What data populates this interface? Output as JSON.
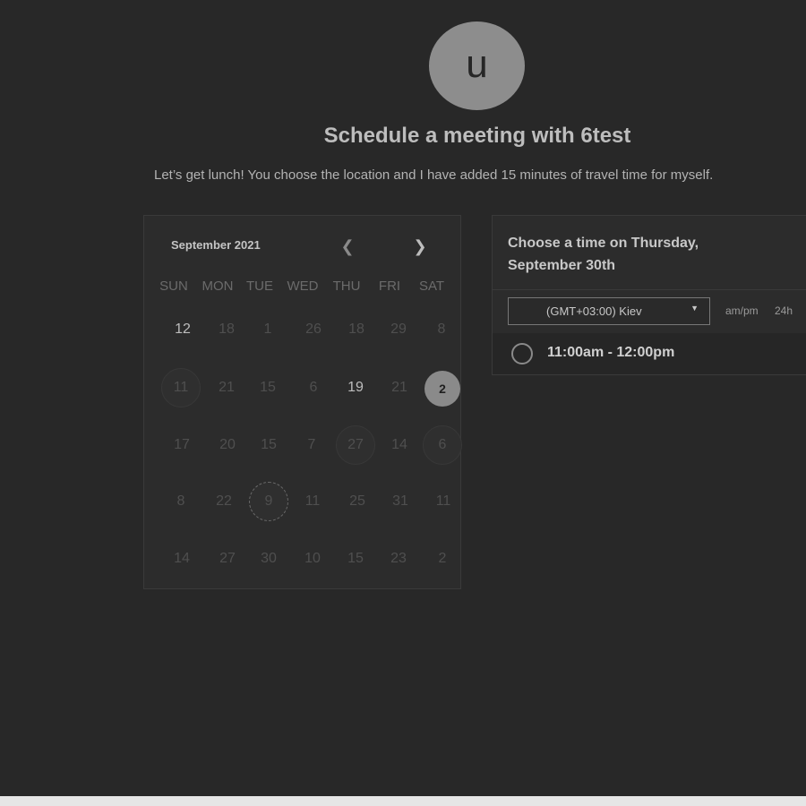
{
  "profile": {
    "avatar_letter": "u"
  },
  "header": {
    "title": "Schedule a meeting with 6test",
    "subtitle": "Let’s get lunch! You choose the location and I have added 15 minutes of travel time for myself."
  },
  "calendar": {
    "month_label": "September 2021",
    "prev_icon": "chevron-left-icon",
    "next_icon": "chevron-right-icon",
    "weekdays": [
      "SUN",
      "MON",
      "TUE",
      "WED",
      "THU",
      "FRI",
      "SAT"
    ],
    "weeks": [
      [
        "12",
        "18",
        "1",
        "26",
        "18",
        "29",
        "8"
      ],
      [
        "11",
        "21",
        "15",
        "6",
        "19",
        "21",
        "2"
      ],
      [
        "17",
        "20",
        "15",
        "7",
        "27",
        "14",
        "6"
      ],
      [
        "8",
        "22",
        "9",
        "11",
        "25",
        "31",
        "11"
      ],
      [
        "14",
        "27",
        "30",
        "10",
        "15",
        "23",
        "2"
      ]
    ],
    "selected_day": "2"
  },
  "time_panel": {
    "heading": "Choose a time on Thursday, September 30th",
    "timezone": "(GMT+03:00) Kiev",
    "format_ampm": "am/pm",
    "format_24h": "24h",
    "slots": [
      "11:00am - 12:00pm"
    ]
  },
  "colors": {
    "background": "#282828",
    "selected_day": "#8a8a8a"
  }
}
